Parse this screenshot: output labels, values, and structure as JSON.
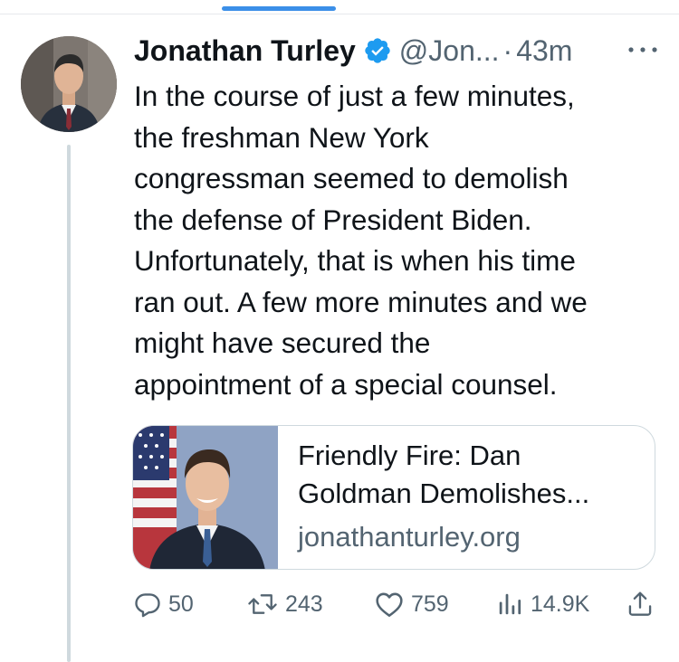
{
  "tweet": {
    "author_name": "Jonathan Turley",
    "handle": "@Jon...",
    "separator": "·",
    "time": "43m",
    "text_lines": [
      "In the course of just a few minutes,",
      "the freshman New York",
      "congressman seemed to demolish",
      "the defense of President Biden.",
      "Unfortunately, that is when his time",
      "ran out. A few more minutes and we",
      "might have secured the",
      "appointment of a special counsel."
    ]
  },
  "card": {
    "title_lines": [
      "Friendly Fire: Dan",
      "Goldman Demolishes..."
    ],
    "domain": "jonathanturley.org"
  },
  "actions": {
    "replies": "50",
    "reposts": "243",
    "likes": "759",
    "views": "14.9K"
  },
  "icons": {
    "verified": "verified-badge-icon",
    "more": "more-icon",
    "reply": "reply-icon",
    "repost": "repost-icon",
    "like": "heart-icon",
    "views": "views-icon",
    "share": "share-icon"
  },
  "colors": {
    "accent": "#1d9bf0",
    "text": "#0f1419",
    "secondary": "#536471",
    "border": "#cfd9de"
  }
}
